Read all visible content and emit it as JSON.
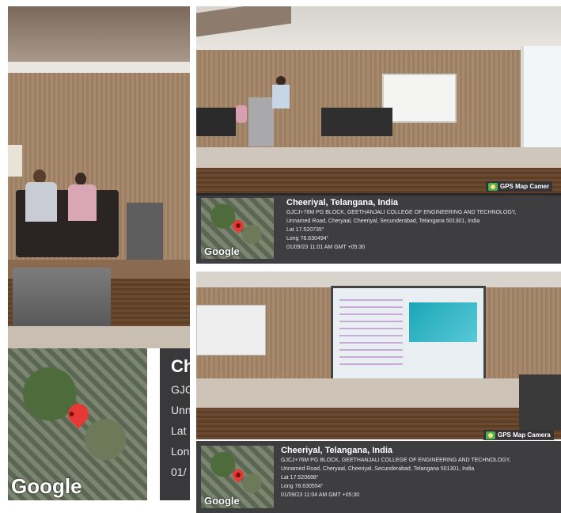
{
  "panels": [
    {
      "id": "left",
      "place": "Ch",
      "lines": [
        "GJC",
        "Unn",
        "Lat",
        "Lon",
        "01/"
      ],
      "map_label": "Google"
    },
    {
      "id": "top-right",
      "place": "Cheeriyal, Telangana, India",
      "lines": [
        "GJCJ+76M PG BLOCK, GEETHANJALI COLLEGE OF ENGINEERING AND TECHNOLOGY,",
        "Unnamed Road, Cheryaal, Cheeriyal, Secunderabad, Telangana 501301, India",
        "Lat 17.520735°",
        "Long 78.630494°",
        "01/09/23 11:01 AM GMT +05:30"
      ],
      "map_label": "Google",
      "badge": "GPS Map Camer"
    },
    {
      "id": "bottom-right",
      "place": "Cheeriyal, Telangana, India",
      "lines": [
        "GJCJ+76M PG BLOCK, GEETHANJALI COLLEGE OF ENGINEERING AND TECHNOLOGY,",
        "Unnamed Road, Cheryaal, Cheeriyal, Secunderabad, Telangana 501301, India",
        "Lat 17.520698°",
        "Long 78.630554°",
        "01/09/23 11:04 AM GMT +05:30"
      ],
      "map_label": "Google",
      "badge": "GPS Map Camera"
    }
  ]
}
